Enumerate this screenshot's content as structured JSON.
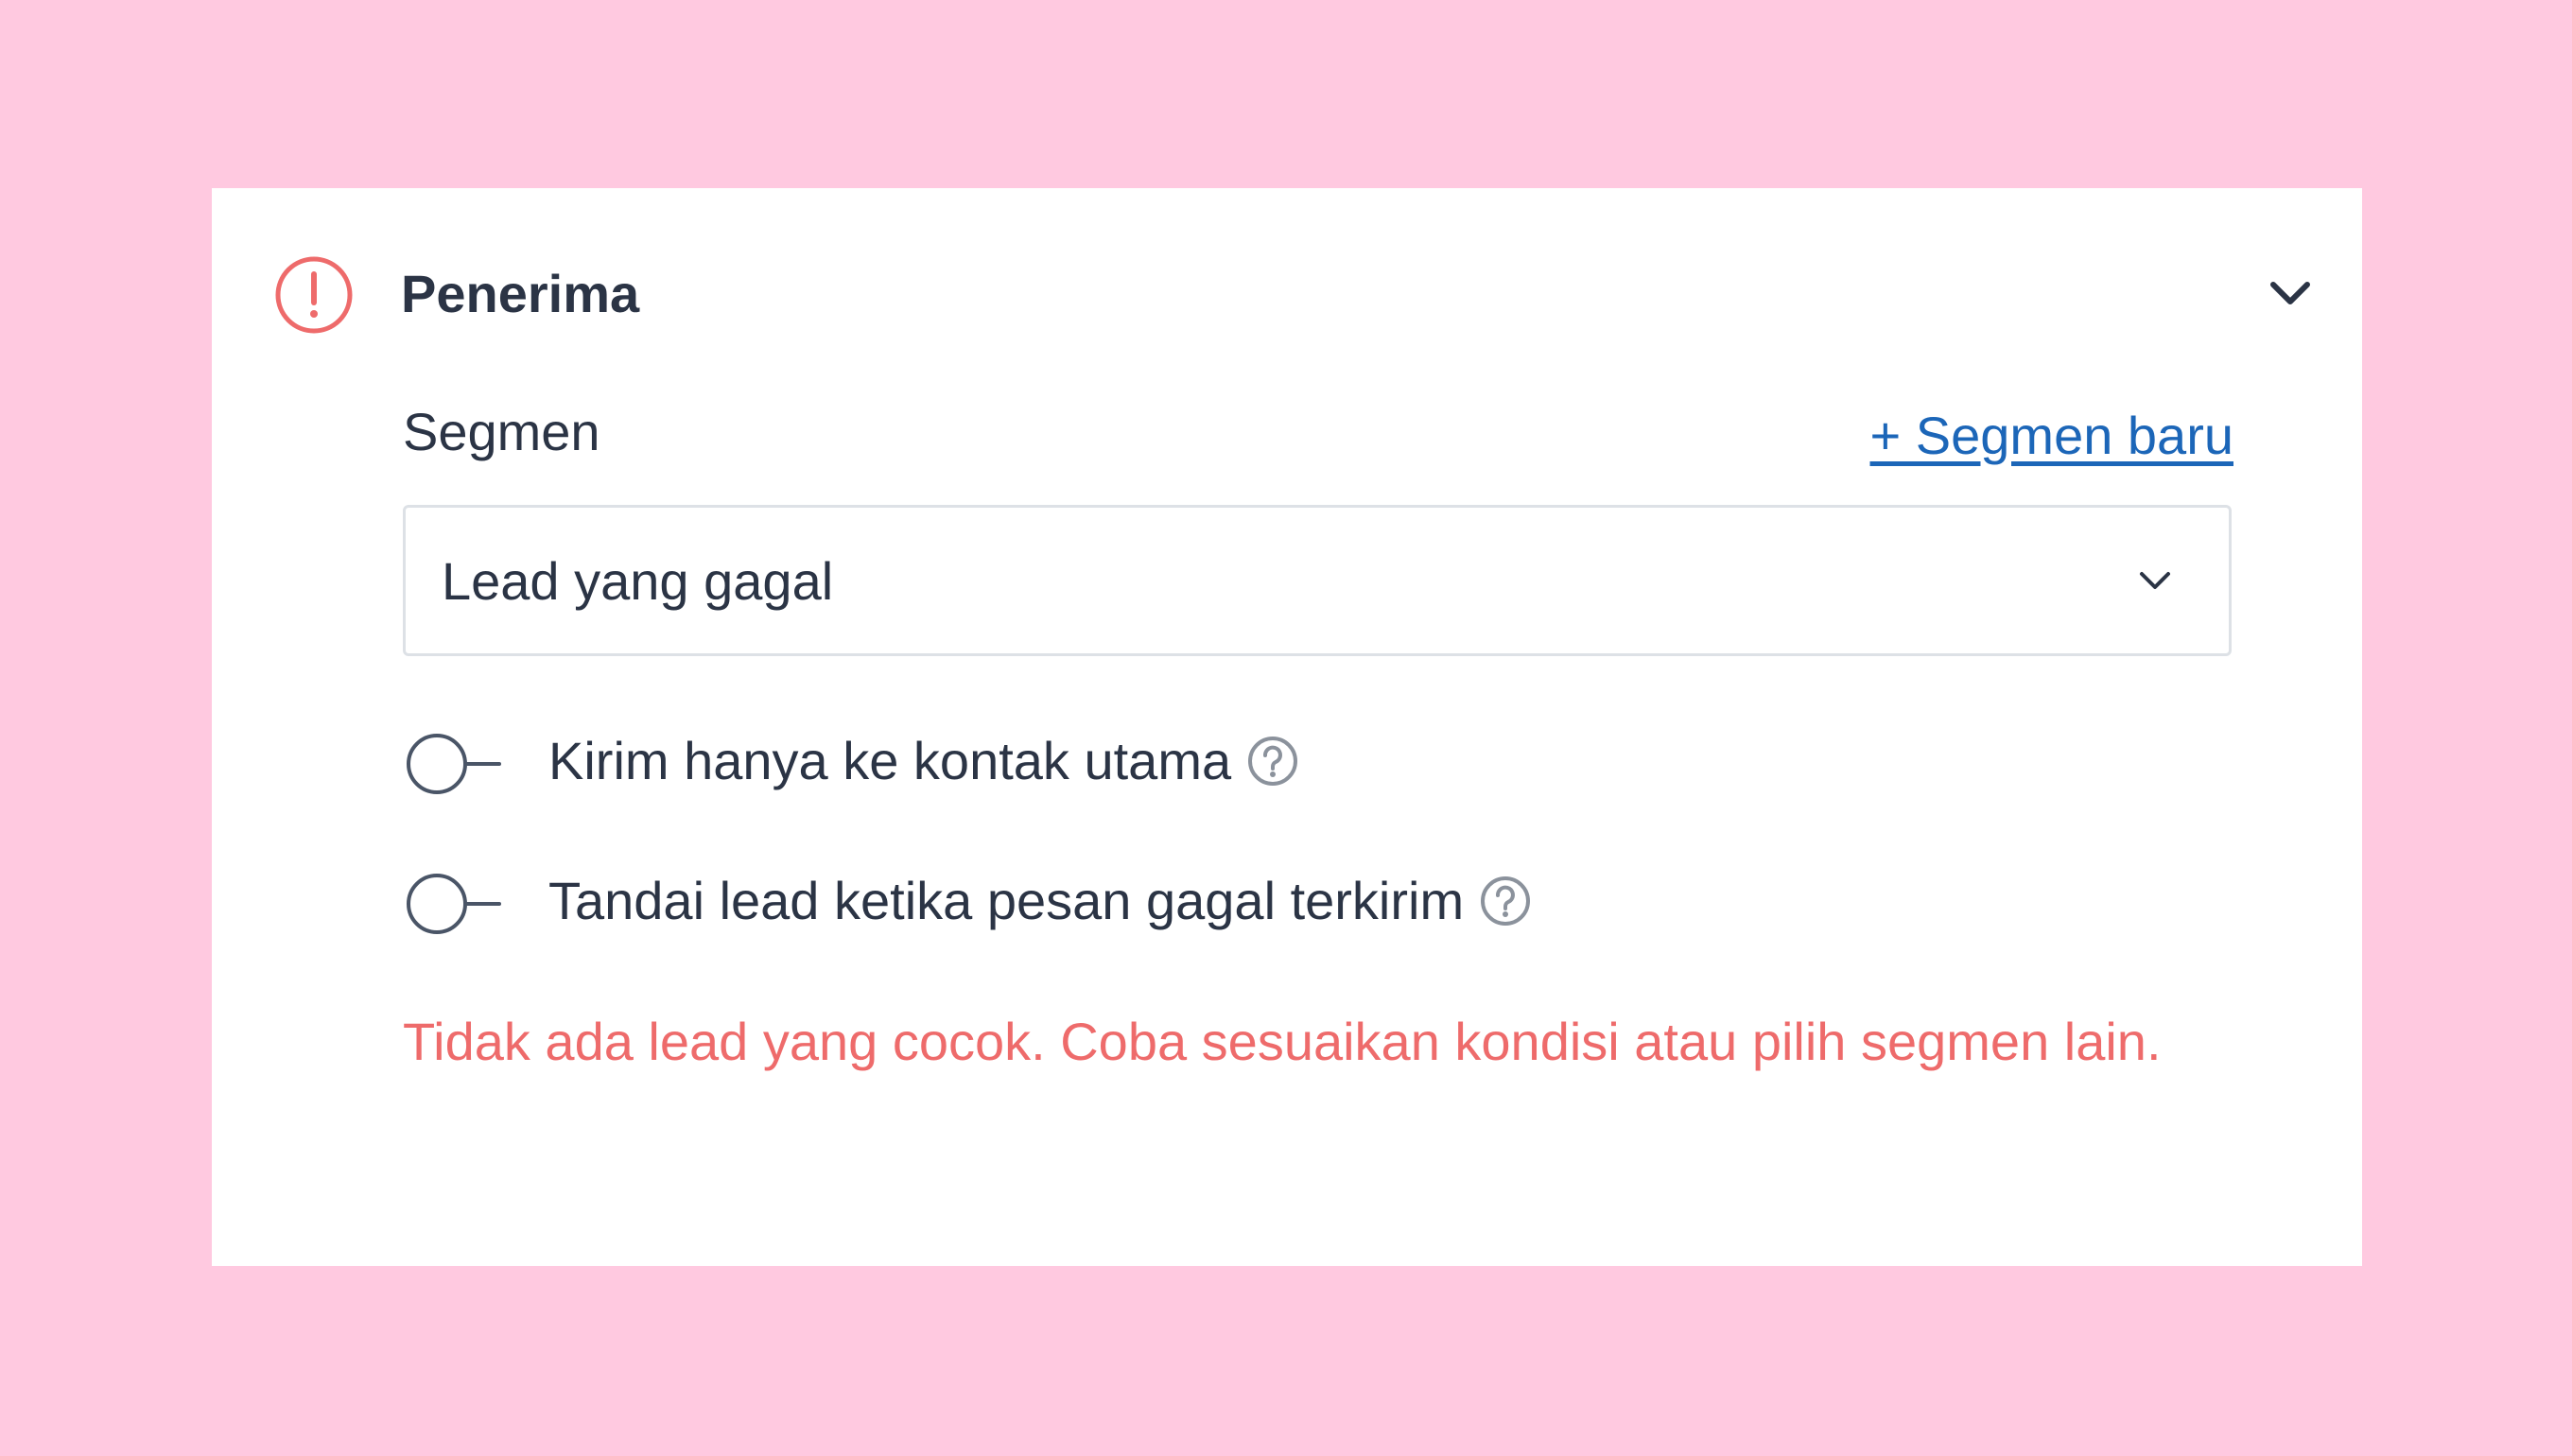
{
  "colors": {
    "page_background": "#ffc9e0",
    "card_background": "#ffffff",
    "text_primary": "#2b3445",
    "link": "#1c66b8",
    "error": "#ee6b6b",
    "border": "#dde1e6"
  },
  "section": {
    "title": "Penerima",
    "status_icon": "error-exclamation-icon",
    "collapse_icon": "chevron-down-icon"
  },
  "segment": {
    "label": "Segmen",
    "new_segment_link": "+ Segmen baru",
    "selected_value": "Lead yang gagal",
    "dropdown_icon": "chevron-down-icon"
  },
  "options": [
    {
      "label": "Kirim hanya ke kontak utama",
      "enabled": false,
      "help_icon": "question-circle-icon"
    },
    {
      "label": "Tandai lead ketika pesan gagal terkirim",
      "enabled": false,
      "help_icon": "question-circle-icon"
    }
  ],
  "error_message": "Tidak ada lead yang cocok. Coba sesuaikan kondisi atau pilih segmen lain."
}
